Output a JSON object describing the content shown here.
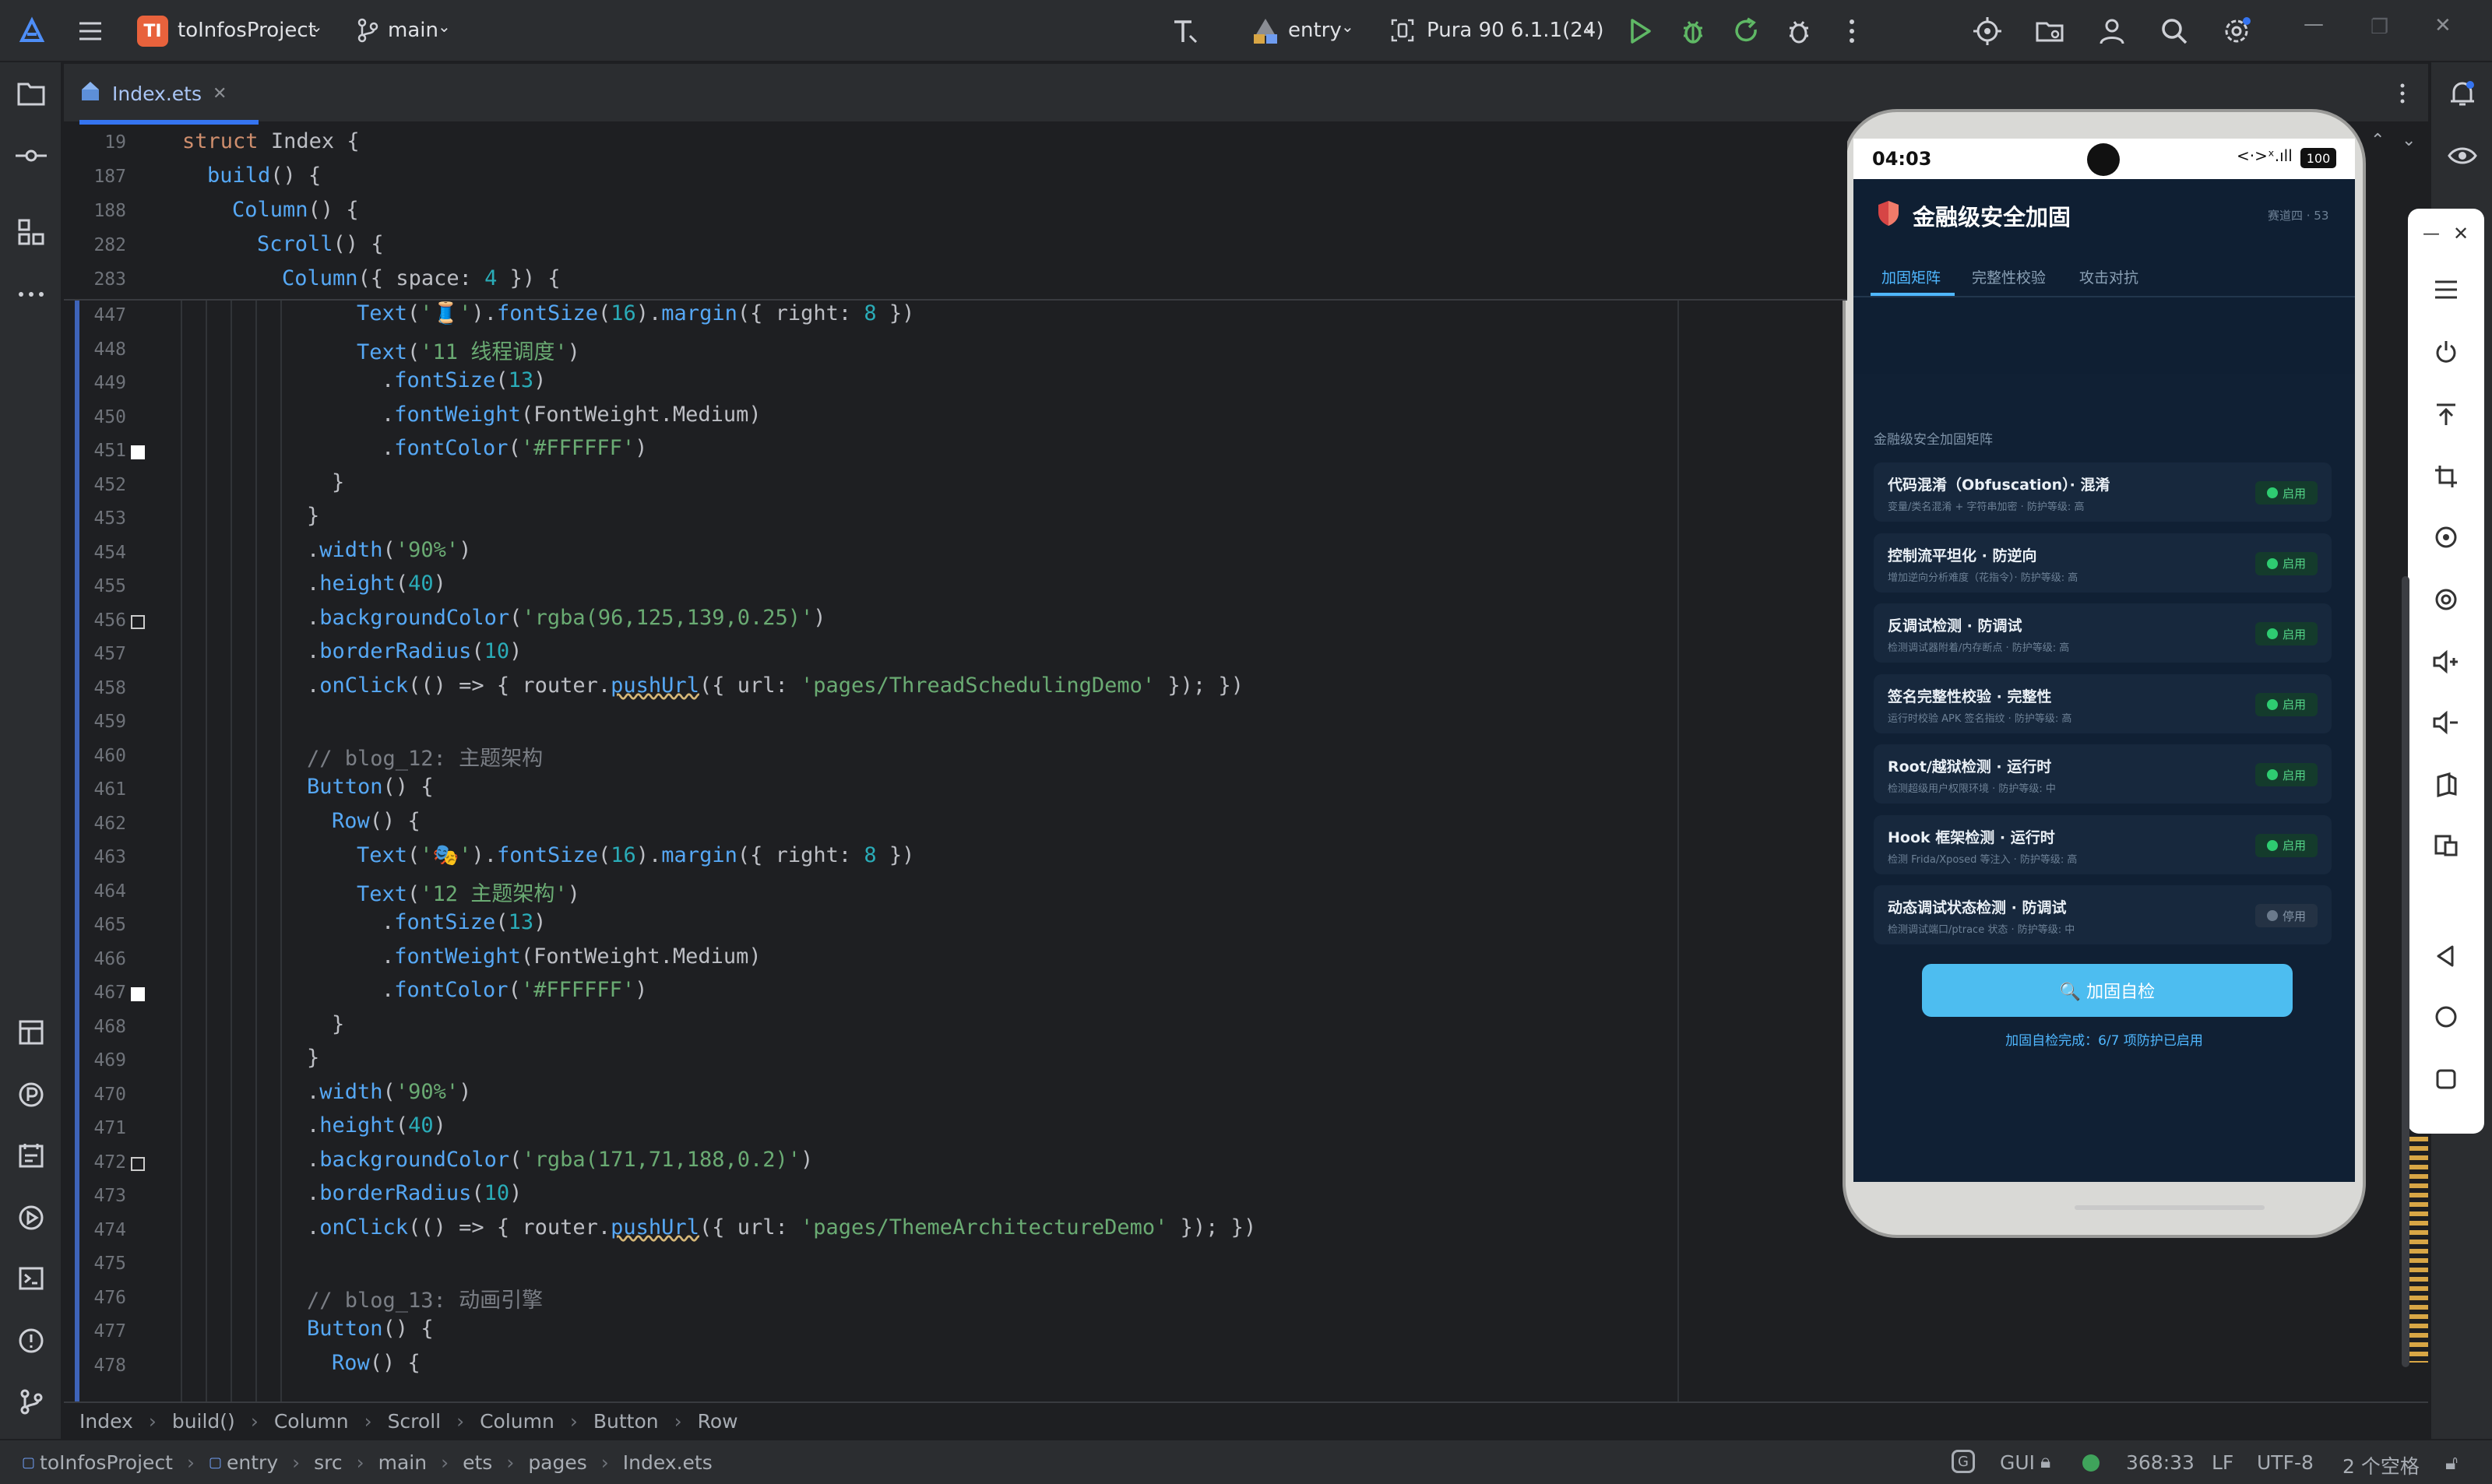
{
  "titlebar": {
    "project_badge": "TI",
    "project_name": "toInfosProject",
    "branch": "main",
    "run_config": "entry",
    "device": "Pura 90 6.1.1(24)"
  },
  "editor_tab": {
    "filename": "Index.ets"
  },
  "sticky_lines": [
    {
      "n": "19",
      "code": "struct Index {"
    },
    {
      "n": "187",
      "code": "build() {"
    },
    {
      "n": "188",
      "code": "Column() {"
    },
    {
      "n": "282",
      "code": "Scroll() {"
    },
    {
      "n": "283",
      "code": "Column({ space: 4 }) {"
    }
  ],
  "code_lines": [
    {
      "n": "447",
      "code": "Text('🧵').fontSize(16).margin({ right: 8 })"
    },
    {
      "n": "448",
      "code": "Text('11 线程调度')"
    },
    {
      "n": "449",
      "code": ".fontSize(13)"
    },
    {
      "n": "450",
      "code": ".fontWeight(FontWeight.Medium)"
    },
    {
      "n": "451",
      "code": ".fontColor('#FFFFFF')"
    },
    {
      "n": "452",
      "code": "}"
    },
    {
      "n": "453",
      "code": "}"
    },
    {
      "n": "454",
      "code": ".width('90%')"
    },
    {
      "n": "455",
      "code": ".height(40)"
    },
    {
      "n": "456",
      "code": ".backgroundColor('rgba(96,125,139,0.25)')"
    },
    {
      "n": "457",
      "code": ".borderRadius(10)"
    },
    {
      "n": "458",
      "code": ".onClick(() => { router.pushUrl({ url: 'pages/ThreadSchedulingDemo' }); })"
    },
    {
      "n": "459",
      "code": ""
    },
    {
      "n": "460",
      "code": "// blog_12: 主题架构"
    },
    {
      "n": "461",
      "code": "Button() {"
    },
    {
      "n": "462",
      "code": "Row() {"
    },
    {
      "n": "463",
      "code": "Text('🎭').fontSize(16).margin({ right: 8 })"
    },
    {
      "n": "464",
      "code": "Text('12 主题架构')"
    },
    {
      "n": "465",
      "code": ".fontSize(13)"
    },
    {
      "n": "466",
      "code": ".fontWeight(FontWeight.Medium)"
    },
    {
      "n": "467",
      "code": ".fontColor('#FFFFFF')"
    },
    {
      "n": "468",
      "code": "}"
    },
    {
      "n": "469",
      "code": "}"
    },
    {
      "n": "470",
      "code": ".width('90%')"
    },
    {
      "n": "471",
      "code": ".height(40)"
    },
    {
      "n": "472",
      "code": ".backgroundColor('rgba(171,71,188,0.2)')"
    },
    {
      "n": "473",
      "code": ".borderRadius(10)"
    },
    {
      "n": "474",
      "code": ".onClick(() => { router.pushUrl({ url: 'pages/ThemeArchitectureDemo' }); })"
    },
    {
      "n": "475",
      "code": ""
    },
    {
      "n": "476",
      "code": "// blog_13: 动画引擎"
    },
    {
      "n": "477",
      "code": "Button() {"
    },
    {
      "n": "478",
      "code": "Row() {"
    }
  ],
  "breadcrumbs": [
    "Index",
    "build()",
    "Column",
    "Scroll",
    "Column",
    "Button",
    "Row"
  ],
  "statusbar": {
    "path": [
      "toInfosProject",
      "entry",
      "src",
      "main",
      "ets",
      "pages",
      "Index.ets"
    ],
    "gui": "GUI",
    "position": "368:33",
    "line_sep": "LF",
    "encoding": "UTF-8",
    "indent": "2 个空格"
  },
  "phone": {
    "time": "04:03",
    "battery": "100",
    "app_title": "金融级安全加固",
    "app_subtitle": "赛道四 · 53",
    "tabs": [
      "加固矩阵",
      "完整性校验",
      "攻击对抗"
    ],
    "section_label": "金融级安全加固矩阵",
    "items": [
      {
        "title": "代码混淆（Obfuscation）· 混淆",
        "sub": "变量/类名混淆 + 字符串加密 · 防护等级: 高",
        "status": "启用",
        "on": true
      },
      {
        "title": "控制流平坦化 · 防逆向",
        "sub": "增加逆向分析难度（花指令）· 防护等级: 高",
        "status": "启用",
        "on": true
      },
      {
        "title": "反调试检测 · 防调试",
        "sub": "检测调试器附着/内存断点 · 防护等级: 高",
        "status": "启用",
        "on": true
      },
      {
        "title": "签名完整性校验 · 完整性",
        "sub": "运行时校验 APK 签名指纹 · 防护等级: 高",
        "status": "启用",
        "on": true
      },
      {
        "title": "Root/越狱检测 · 运行时",
        "sub": "检测超级用户权限环境 · 防护等级: 中",
        "status": "启用",
        "on": true
      },
      {
        "title": "Hook 框架检测 · 运行时",
        "sub": "检测 Frida/Xposed 等注入 · 防护等级: 高",
        "status": "启用",
        "on": true
      },
      {
        "title": "动态调试状态检测 · 防调试",
        "sub": "检测调试端口/ptrace 状态 · 防护等级: 中",
        "status": "停用",
        "on": false
      }
    ],
    "button_label": "🔍 加固自检",
    "result_text": "加固自检完成：6/7 项防护已启用"
  },
  "colors": {
    "accent": "#3574f0",
    "phone_bg": "#102034",
    "phone_button": "#4dbdf0",
    "enabled_green": "#2ecc71"
  }
}
